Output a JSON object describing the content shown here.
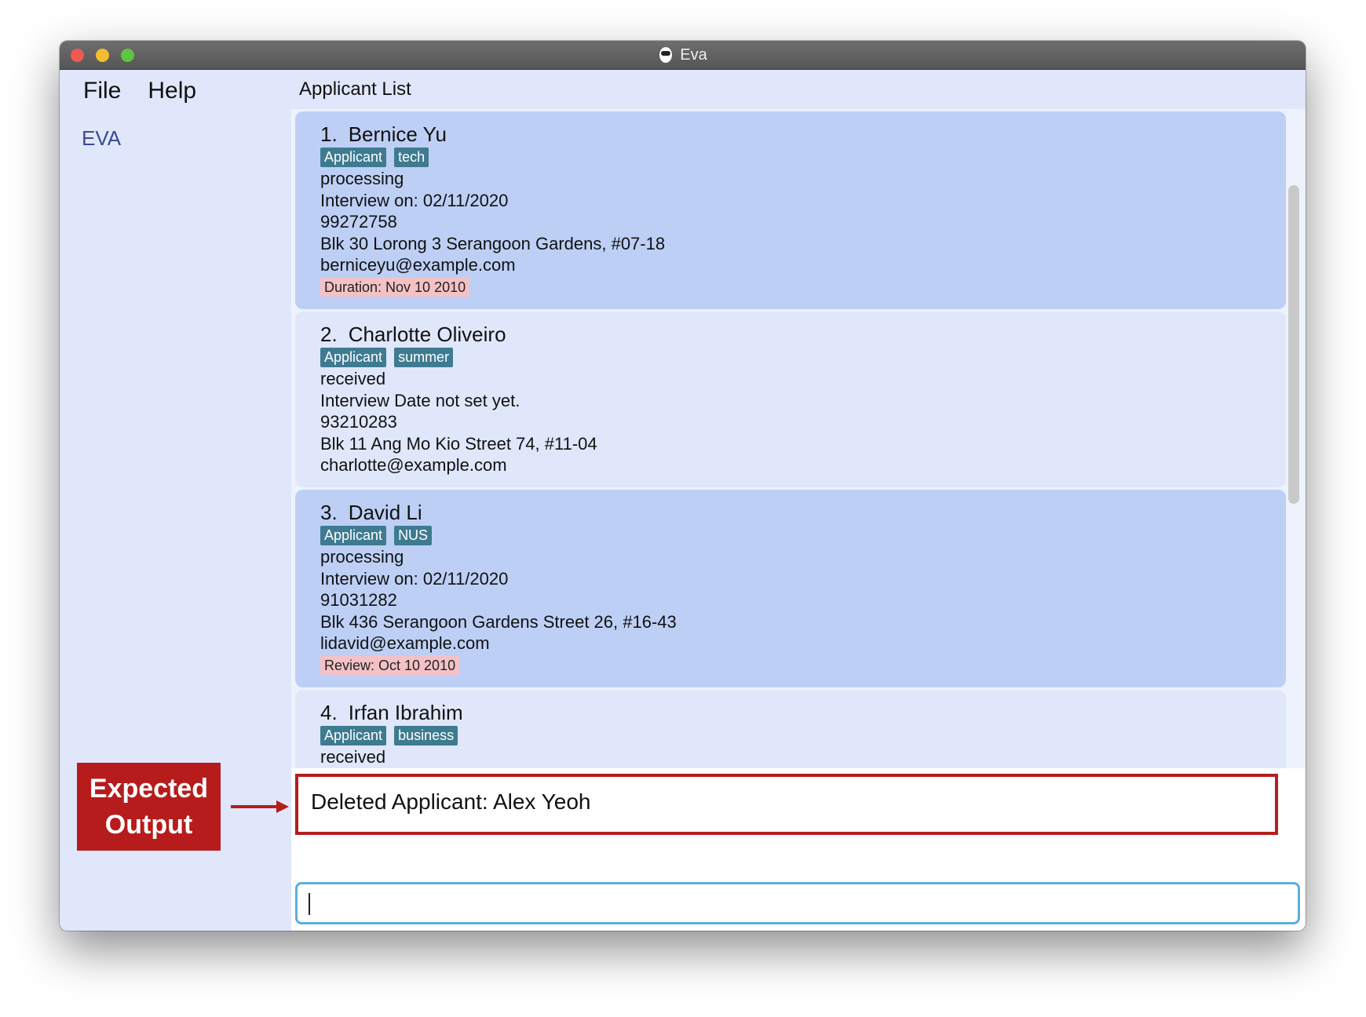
{
  "window": {
    "title": "Eva"
  },
  "menu": {
    "items": [
      "File",
      "Help"
    ]
  },
  "sidebar": {
    "brand": "EVA"
  },
  "list": {
    "header": "Applicant List",
    "cards": [
      {
        "index": "1.",
        "name": "Bernice Yu",
        "tags": [
          "Applicant",
          "tech"
        ],
        "lines": [
          "processing",
          "Interview on: 02/11/2020",
          "99272758",
          "Blk 30 Lorong 3 Serangoon Gardens, #07-18",
          "berniceyu@example.com"
        ],
        "remark": "Duration: Nov 10 2010"
      },
      {
        "index": "2.",
        "name": "Charlotte Oliveiro",
        "tags": [
          "Applicant",
          "summer"
        ],
        "lines": [
          "received",
          "Interview Date not set yet.",
          "93210283",
          "Blk 11 Ang Mo Kio Street 74, #11-04",
          "charlotte@example.com"
        ],
        "remark": ""
      },
      {
        "index": "3.",
        "name": "David Li",
        "tags": [
          "Applicant",
          "NUS"
        ],
        "lines": [
          "processing",
          "Interview on: 02/11/2020",
          "91031282",
          "Blk 436 Serangoon Gardens Street 26, #16-43",
          "lidavid@example.com"
        ],
        "remark": "Review: Oct 10 2010"
      },
      {
        "index": "4.",
        "name": "Irfan Ibrahim",
        "tags": [
          "Applicant",
          "business"
        ],
        "lines": [
          "received"
        ],
        "remark": ""
      }
    ]
  },
  "result": {
    "text": "Deleted Applicant: Alex Yeoh"
  },
  "command": {
    "value": ""
  },
  "annotation": {
    "line1": "Expected",
    "line2": "Output"
  },
  "colors": {
    "card_odd": "#bdcff5",
    "card_even": "#e0e7fb",
    "tag": "#3e7b91",
    "remark": "#f4c2c6",
    "highlight_border": "#b41f1f",
    "command_border": "#5aaee3"
  }
}
